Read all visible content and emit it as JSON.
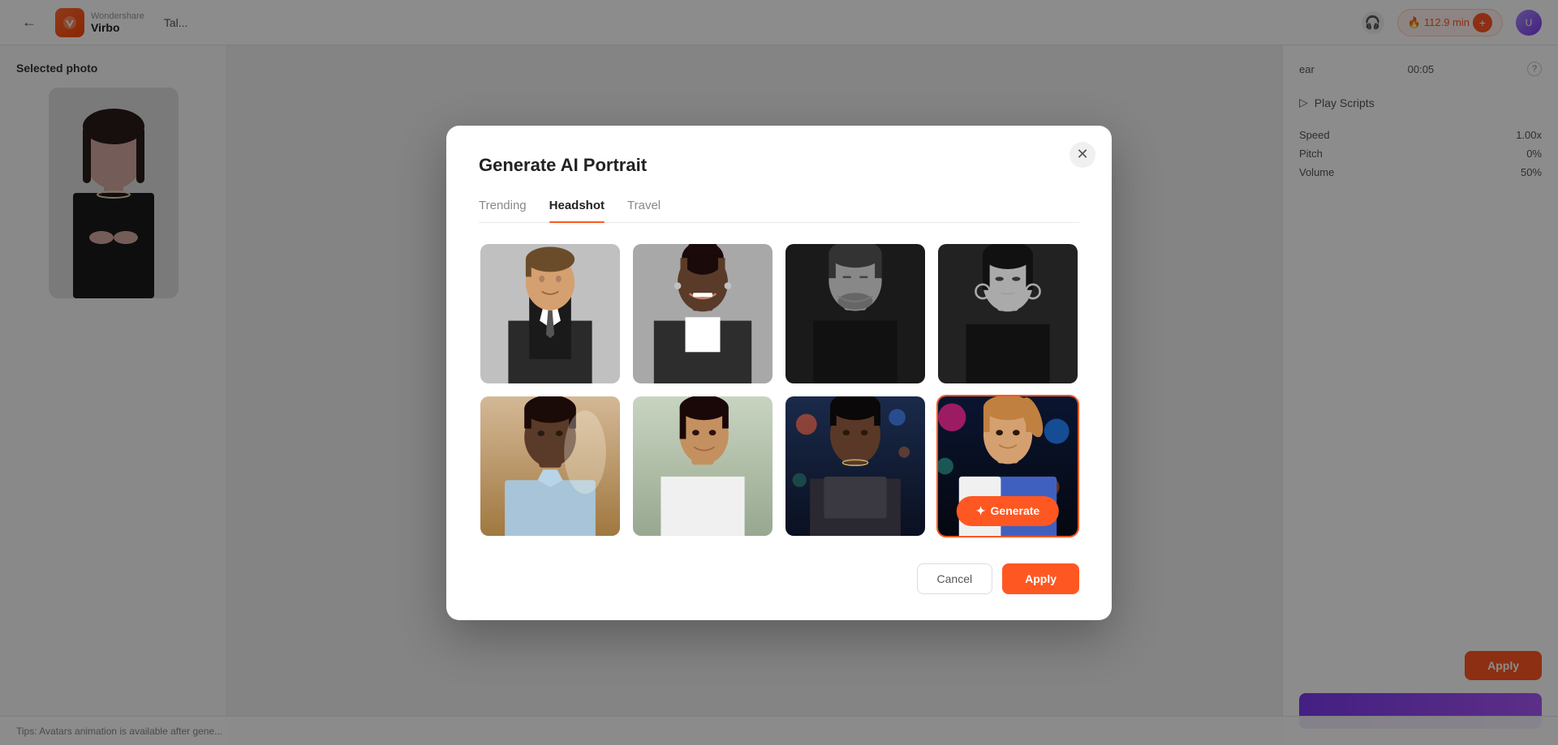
{
  "app": {
    "logo_brand": "Wondershare",
    "logo_product": "Virbo",
    "tab_name": "Tal...",
    "credits": "112.9 min",
    "back_label": "←"
  },
  "left_panel": {
    "title": "Selected photo"
  },
  "right_sidebar": {
    "time_display": "00:05",
    "play_scripts_label": "Play Scripts",
    "speed_value": "1.00x",
    "pitch_value": "0%",
    "volume_value": "50%",
    "apply_button": "Apply"
  },
  "tips": {
    "text": "Tips: Avatars animation is available after gene..."
  },
  "modal": {
    "title": "Generate AI Portrait",
    "tabs": [
      {
        "id": "trending",
        "label": "Trending",
        "active": false
      },
      {
        "id": "headshot",
        "label": "Headshot",
        "active": true
      },
      {
        "id": "travel",
        "label": "Travel",
        "active": false
      }
    ],
    "images": [
      {
        "id": "img1",
        "description": "Professional man in suit, smiling, gray background",
        "bg_color": "#c8c8c8",
        "selected": false,
        "row": 0,
        "col": 0
      },
      {
        "id": "img2",
        "description": "Professional Black woman smiling, blazer, gray background",
        "bg_color": "#b0b0b0",
        "selected": false,
        "row": 0,
        "col": 1
      },
      {
        "id": "img3",
        "description": "Black and white portrait of man, moody lighting",
        "bg_color": "#404040",
        "selected": false,
        "row": 0,
        "col": 2
      },
      {
        "id": "img4",
        "description": "Black and white portrait of Asian woman, hoops",
        "bg_color": "#303030",
        "selected": false,
        "row": 0,
        "col": 3
      },
      {
        "id": "img5",
        "description": "Young Black man in light blue shirt, warm indoor light",
        "bg_color": "#d4b896",
        "selected": false,
        "row": 1,
        "col": 0
      },
      {
        "id": "img6",
        "description": "South Asian woman smiling, white blouse, cafe background",
        "bg_color": "#c8d4c0",
        "selected": false,
        "row": 1,
        "col": 1
      },
      {
        "id": "img7",
        "description": "Black man in city street, night, colorful lights",
        "bg_color": "#1a2a4a",
        "selected": false,
        "row": 1,
        "col": 2
      },
      {
        "id": "img8",
        "description": "Woman with ponytail, colorful neon city background, selected",
        "bg_color": "#0a1530",
        "selected": true,
        "row": 1,
        "col": 3
      }
    ],
    "generate_button": "Generate",
    "generate_icon": "✦",
    "cancel_button": "Cancel",
    "apply_button": "Apply"
  }
}
